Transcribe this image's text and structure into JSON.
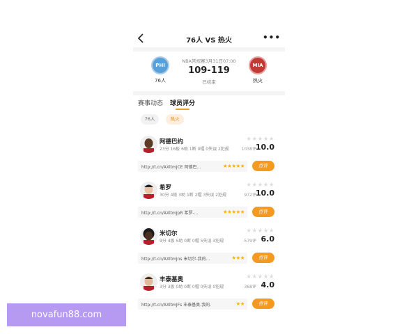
{
  "header": {
    "title": "76人 VS 热火",
    "more": "•••"
  },
  "game": {
    "info": "NBA常规赛3月31日07:00",
    "score": "109-119",
    "status": "已结束",
    "home": {
      "abbr": "PHI",
      "name": "76人",
      "color": "#5aa0d8"
    },
    "away": {
      "abbr": "MIA",
      "name": "热火",
      "color": "#c23a36"
    }
  },
  "tabs": [
    {
      "label": "赛事动态"
    },
    {
      "label": "球员评分"
    }
  ],
  "team_filter": [
    {
      "label": "76人"
    },
    {
      "label": "热火"
    }
  ],
  "players": [
    {
      "name": "阿德巴约",
      "stats": "23分 16板 6助 1断 0帽 0失误 2犯规",
      "count": "1038评",
      "rating": "10.0",
      "link": "http://t.cn/AXltmJCE 阿德巴...",
      "mini_stars": "★★★★★",
      "button": "点评"
    },
    {
      "name": "希罗",
      "stats": "30分 4板 3助 1断 2帽 3失误 2犯规",
      "count": "972评",
      "rating": "10.0",
      "link": "http://t.cn/AXltmJpR 希罗-...",
      "mini_stars": "★★★★★",
      "button": "点评"
    },
    {
      "name": "米切尔",
      "stats": "9分 4板 5助 0断 0帽 5失误 3犯规",
      "count": "579评",
      "rating": "6.0",
      "link": "http://t.cn/AXltmJns 米切尔-我的...",
      "mini_stars": "★★★",
      "button": "点评"
    },
    {
      "name": "丰泰基奥",
      "stats": "3分 3板 0助 0断 0帽 0失误 0犯规",
      "count": "368评",
      "rating": "4.0",
      "link": "http://t.cn/AXltmJFs 丰泰基奥-我的...",
      "mini_stars": "★★",
      "button": "点评"
    }
  ],
  "rating_stars": "★★★★★",
  "accent_color": "#f49a21",
  "watermark": "novafun88.com"
}
